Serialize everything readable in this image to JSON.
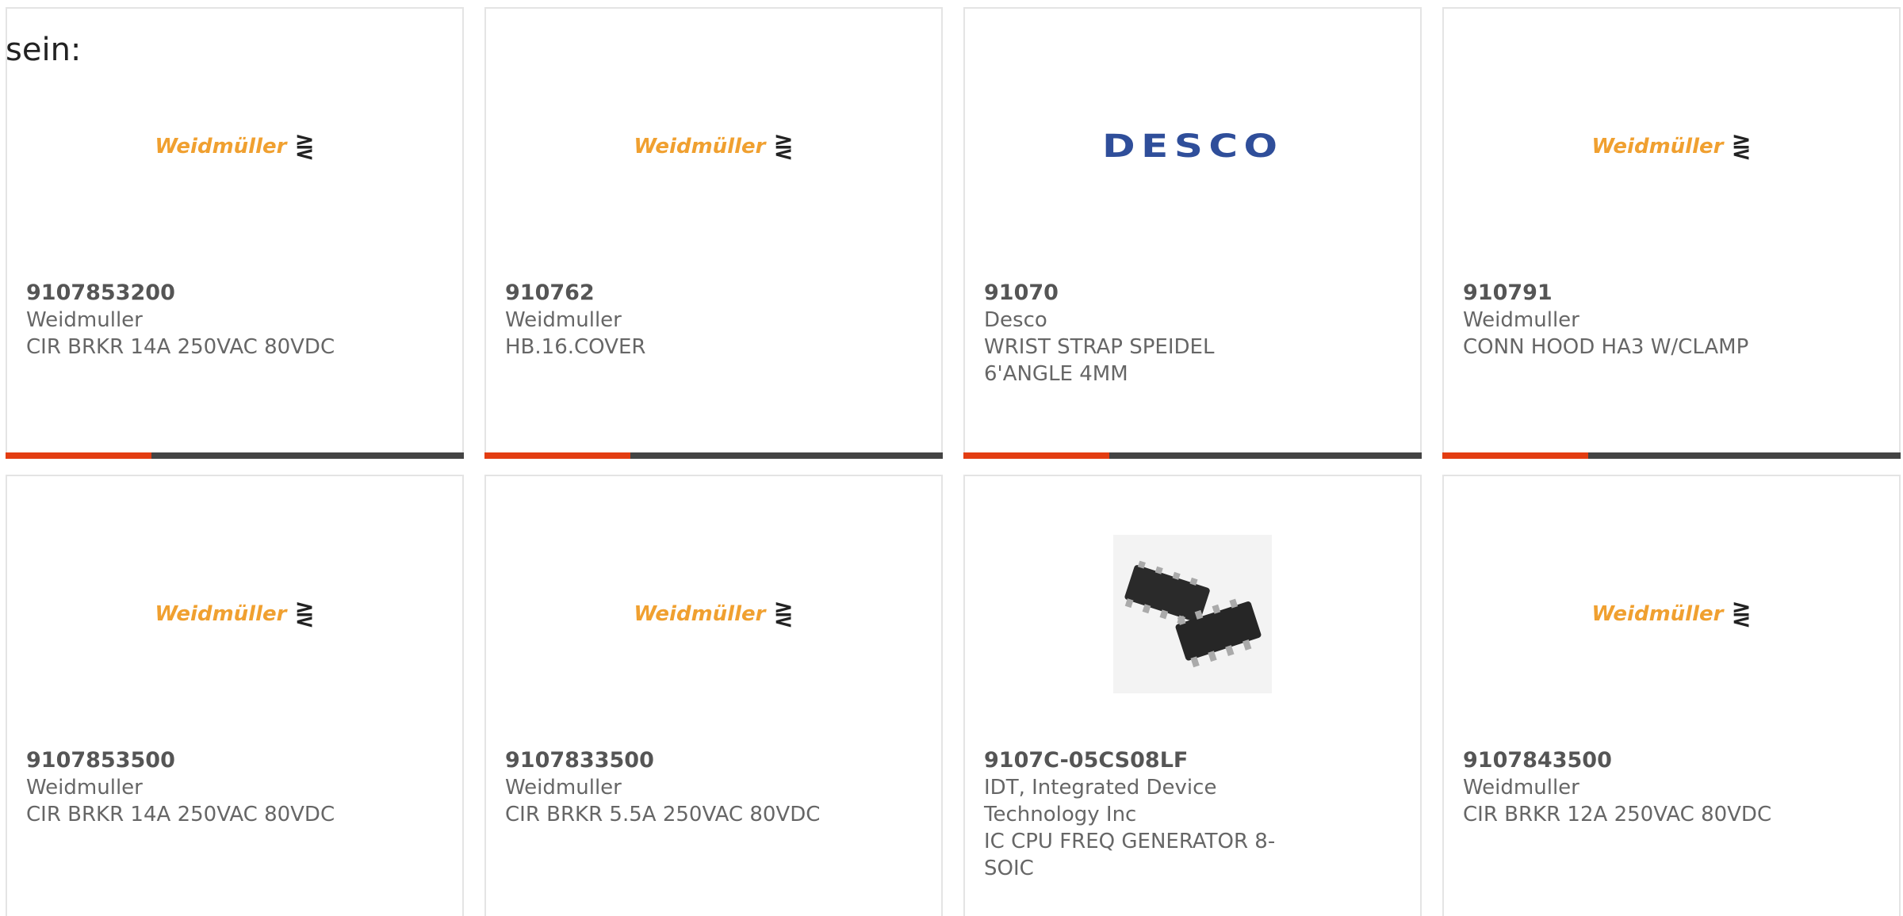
{
  "intro_text": "sein:",
  "brand_colors": {
    "accent_bar": "#e33d12",
    "bar_dark": "#444444",
    "weidmuller_orange": "#f0a030",
    "desco_blue": "#2f4e9a"
  },
  "products": [
    {
      "logo": "Weidmüller",
      "logo_mark": "⋛",
      "part_number": "9107853200",
      "manufacturer": "Weidmuller",
      "description": "CIR BRKR 14A 250VAC 80VDC"
    },
    {
      "logo": "Weidmüller",
      "logo_mark": "⋛",
      "part_number": "910762",
      "manufacturer": "Weidmuller",
      "description": "HB.16.COVER"
    },
    {
      "logo": "DESCO",
      "part_number": "91070",
      "manufacturer": "Desco",
      "description": "WRIST STRAP SPEIDEL 6'ANGLE 4MM"
    },
    {
      "logo": "Weidmüller",
      "logo_mark": "⋛",
      "part_number": "910791",
      "manufacturer": "Weidmuller",
      "description": "CONN HOOD HA3 W/CLAMP"
    },
    {
      "logo": "Weidmüller",
      "logo_mark": "⋛",
      "part_number": "9107853500",
      "manufacturer": "Weidmuller",
      "description": "CIR BRKR 14A 250VAC 80VDC"
    },
    {
      "logo": "Weidmüller",
      "logo_mark": "⋛",
      "part_number": "9107833500",
      "manufacturer": "Weidmuller",
      "description": "CIR BRKR 5.5A 250VAC 80VDC"
    },
    {
      "image_icon": "soic-8-chip-image",
      "part_number": "9107C-05CS08LF",
      "manufacturer": "IDT, Integrated Device Technology Inc",
      "description": "IC CPU FREQ GENERATOR 8-SOIC"
    },
    {
      "logo": "Weidmüller",
      "logo_mark": "⋛",
      "part_number": "9107843500",
      "manufacturer": "Weidmuller",
      "description": "CIR BRKR 12A 250VAC 80VDC"
    }
  ]
}
